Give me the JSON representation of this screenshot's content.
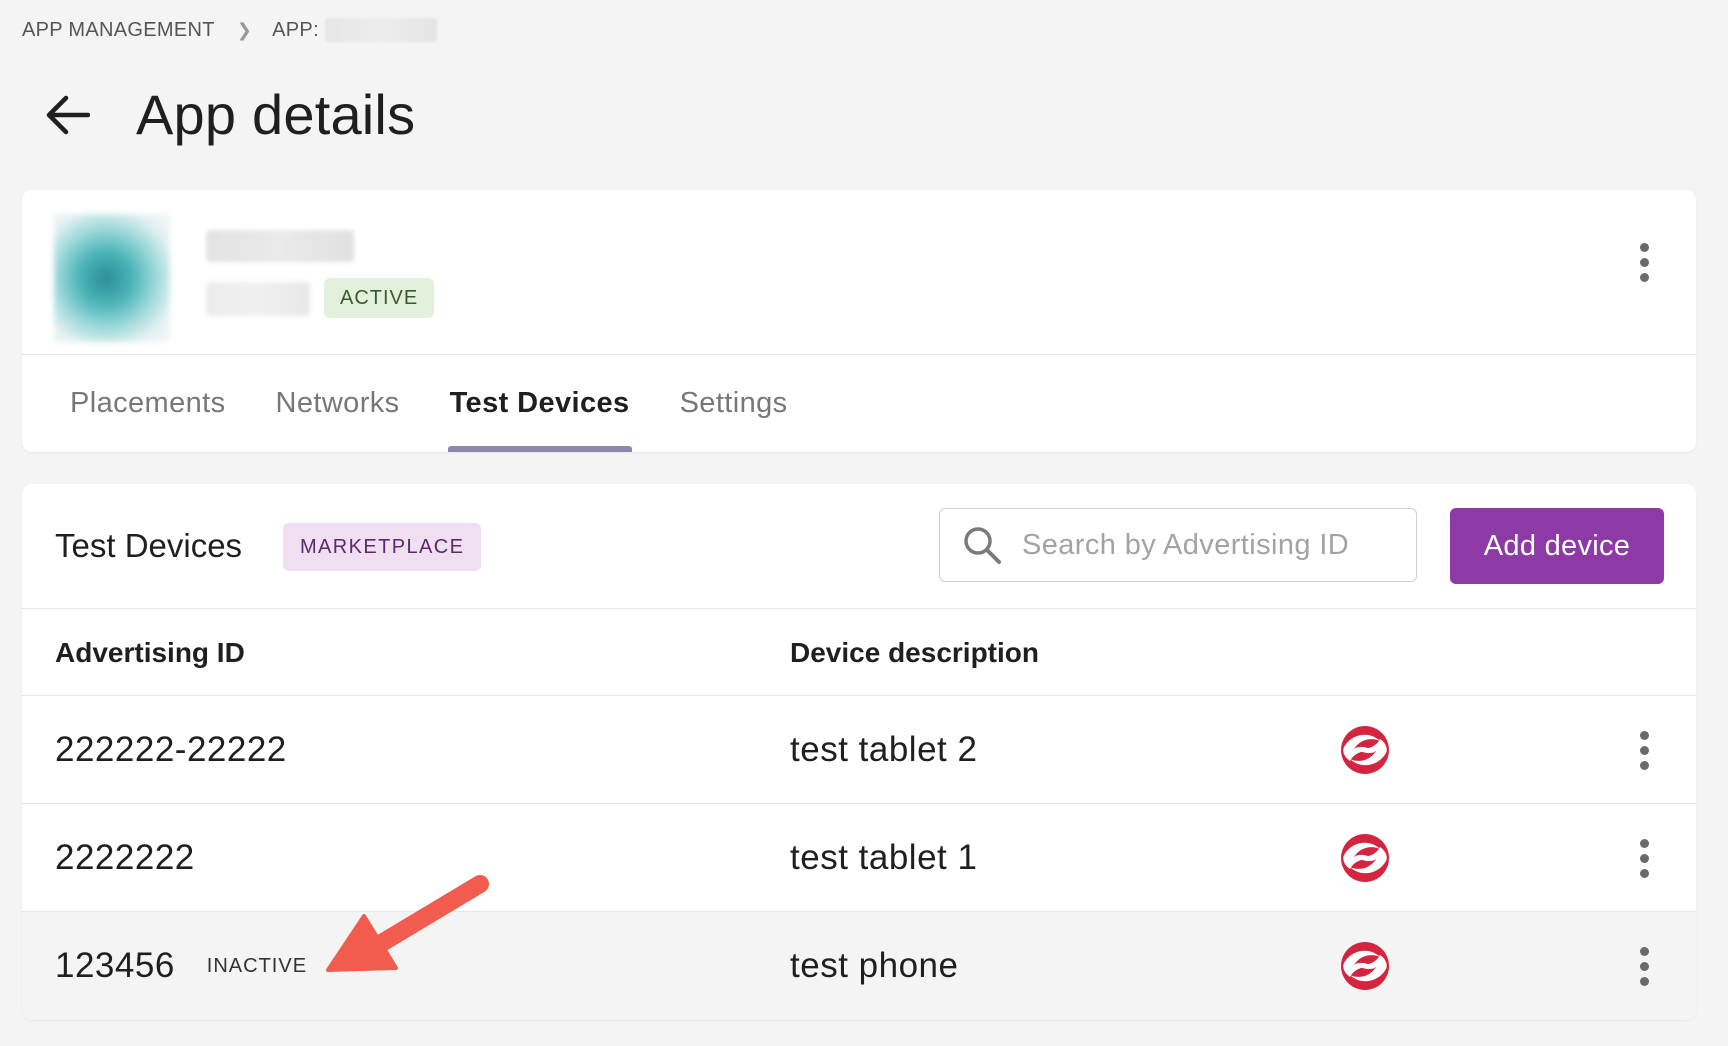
{
  "breadcrumb": {
    "root": "APP MANAGEMENT",
    "current_label": "APP:"
  },
  "header": {
    "title": "App details"
  },
  "app": {
    "status": "ACTIVE"
  },
  "tabs": [
    {
      "label": "Placements",
      "active": false
    },
    {
      "label": "Networks",
      "active": false
    },
    {
      "label": "Test Devices",
      "active": true
    },
    {
      "label": "Settings",
      "active": false
    }
  ],
  "devices": {
    "title": "Test Devices",
    "badge": "MARKETPLACE",
    "search": {
      "placeholder": "Search by Advertising ID",
      "value": ""
    },
    "add_button": "Add device",
    "columns": [
      "Advertising ID",
      "Device description"
    ],
    "rows": [
      {
        "id": "222222-22222",
        "description": "test tablet 2",
        "status": "",
        "network_icon": "network-logo-icon"
      },
      {
        "id": "2222222",
        "description": "test tablet 1",
        "status": "",
        "network_icon": "network-logo-icon"
      },
      {
        "id": "123456",
        "description": "test phone",
        "status": "INACTIVE",
        "network_icon": "network-logo-icon"
      }
    ]
  },
  "colors": {
    "accent": "#8d3aa6",
    "active_badge_bg": "#e2f0dc",
    "marketplace_badge_bg": "#efdff0",
    "tab_indicator": "#8a87ad",
    "network_logo": "#d4243f",
    "annotation_arrow": "#f25c4f"
  }
}
